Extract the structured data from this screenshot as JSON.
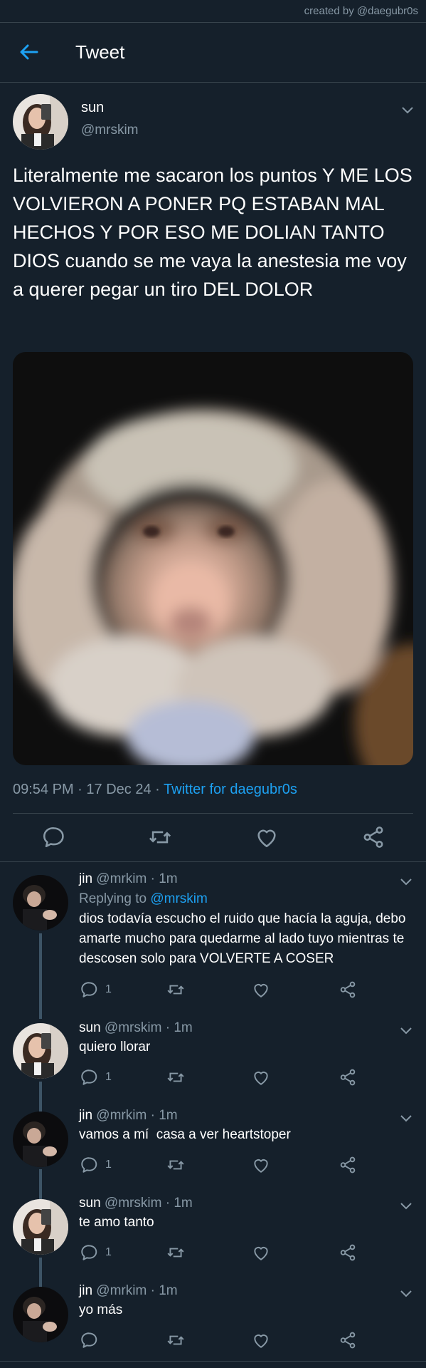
{
  "watermark": "created by @daegubr0s",
  "header": {
    "title": "Tweet"
  },
  "tweet": {
    "name": "sun",
    "handle": "@mrskim",
    "text": "Literalmente me sacaron los puntos Y ME LOS VOLVIERON A PONER PQ ESTABAN MAL HECHOS Y POR ESO ME DOLIAN TANTO DIOS cuando se me vaya la anestesia me voy a querer pegar un tiro DEL DOLOR",
    "time": "09:54 PM",
    "date": "17 Dec 24",
    "sep": "·",
    "client": "Twitter for daegubr0s"
  },
  "replies": [
    {
      "name": "jin",
      "handle": "@mrkim",
      "time": "1m",
      "replying_to_label": "Replying to",
      "replying_to": "@mrskim",
      "text": "dios todavía escucho el ruido que hacía la aguja, debo amarte mucho para quedarme al lado tuyo mientras te descosen solo para VOLVERTE A COSER",
      "reply_count": "1"
    },
    {
      "name": "sun",
      "handle": "@mrskim",
      "time": "1m",
      "text": "quiero llorar",
      "reply_count": "1"
    },
    {
      "name": "jin",
      "handle": "@mrkim",
      "time": "1m",
      "text": "vamos a mí  casa a ver heartstoper",
      "reply_count": "1"
    },
    {
      "name": "sun",
      "handle": "@mrskim",
      "time": "1m",
      "text": "te amo tanto",
      "reply_count": "1"
    },
    {
      "name": "jin",
      "handle": "@mrkim",
      "time": "1m",
      "text": "yo más",
      "reply_count": ""
    }
  ],
  "icons": {
    "back": "arrow-left-icon",
    "more": "chevron-down-icon",
    "reply": "comment-icon",
    "retweet": "retweet-icon",
    "like": "heart-icon",
    "share": "share-icon"
  },
  "colors": {
    "background": "#15202b",
    "accent": "#1da1f2",
    "muted": "#8899a6",
    "divider": "#38444d"
  }
}
